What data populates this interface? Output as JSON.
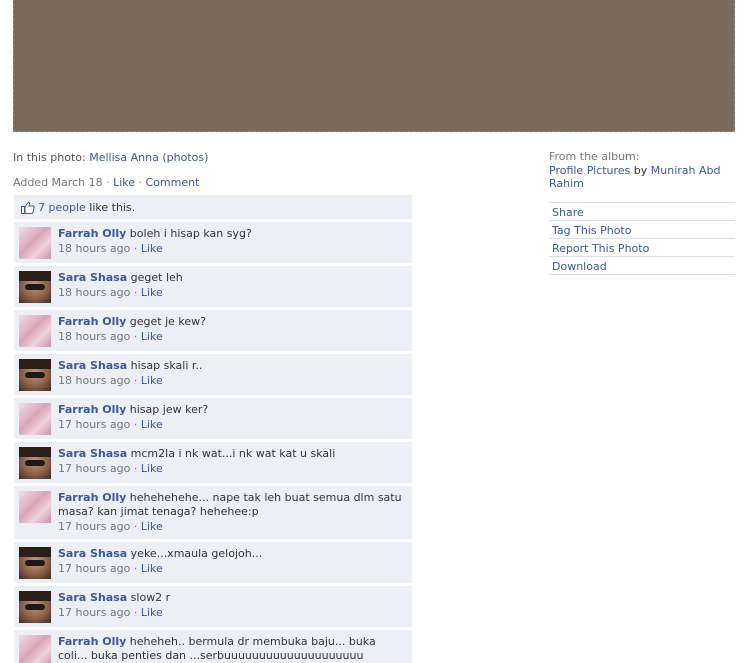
{
  "photo": {
    "placeholder_note": "Photo omitted"
  },
  "caption": {
    "in_photo_prefix": "In this photo:",
    "tagged_name": "Mellisa Anna",
    "photos_link": "photos",
    "added": "Added March 18",
    "like": "Like",
    "comment": "Comment"
  },
  "likes": {
    "count_link": "7 people",
    "suffix": "like this."
  },
  "comments": [
    {
      "author": "Farrah Olly",
      "text": "boleh i hisap kan syg?",
      "time": "18 hours ago",
      "like": "Like",
      "avatar": "farrah"
    },
    {
      "author": "Sara Shasa",
      "text": "geget leh",
      "time": "18 hours ago",
      "like": "Like",
      "avatar": "sara"
    },
    {
      "author": "Farrah Olly",
      "text": "geget je kew?",
      "time": "18 hours ago",
      "like": "Like",
      "avatar": "farrah"
    },
    {
      "author": "Sara Shasa",
      "text": "hisap skali r..",
      "time": "18 hours ago",
      "like": "Like",
      "avatar": "sara"
    },
    {
      "author": "Farrah Olly",
      "text": "hisap jew ker?",
      "time": "17 hours ago",
      "like": "Like",
      "avatar": "farrah"
    },
    {
      "author": "Sara Shasa",
      "text": "mcm2la i nk wat...i nk wat kat u skali",
      "time": "17 hours ago",
      "like": "Like",
      "avatar": "sara"
    },
    {
      "author": "Farrah Olly",
      "text": "hehehehehe... nape tak leh buat semua dlm satu masa? kan jimat tenaga? hehehee:p",
      "time": "17 hours ago",
      "like": "Like",
      "avatar": "farrah"
    },
    {
      "author": "Sara Shasa",
      "text": "yeke...xmaula gelojoh...",
      "time": "17 hours ago",
      "like": "Like",
      "avatar": "sara"
    },
    {
      "author": "Sara Shasa",
      "text": "slow2 r",
      "time": "17 hours ago",
      "like": "Like",
      "avatar": "sara"
    },
    {
      "author": "Farrah Olly",
      "text": "heheheh.. bermula dr membuka baju... buka coli... buka penties dan ...serbuuuuuuuuuuuuuuuuuuuu",
      "time": "",
      "like": "",
      "avatar": "farrah"
    }
  ],
  "sidebar": {
    "from_album": "From the album:",
    "album_name": "Profile Pictures",
    "by": "by",
    "owner": "Munirah Abd Rahim",
    "actions": [
      "Share",
      "Tag This Photo",
      "Report This Photo",
      "Download"
    ]
  },
  "colors": {
    "link": "#3b5998",
    "comment_bg": "#eceff5"
  }
}
